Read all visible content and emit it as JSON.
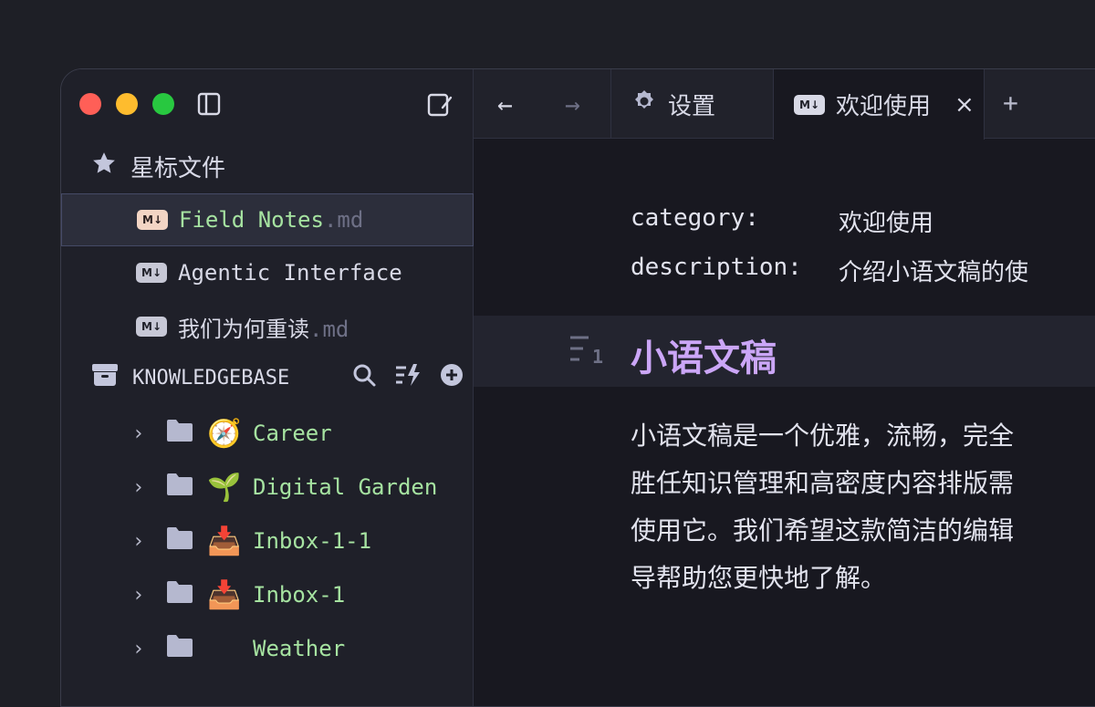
{
  "sidebar": {
    "starred": {
      "title": "星标文件",
      "files": [
        {
          "name": "Field Notes",
          "ext": ".md",
          "active": true,
          "badge": "M↓"
        },
        {
          "name": "Agentic Interface",
          "ext": "",
          "active": false,
          "badge": "M↓"
        },
        {
          "name": "我们为何重读",
          "ext": ".md",
          "active": false,
          "badge": "M↓"
        }
      ]
    },
    "knowledgebase": {
      "title": "KNOWLEDGEBASE",
      "folders": [
        {
          "emoji": "🧭",
          "name": "Career"
        },
        {
          "emoji": "🌱",
          "name": "Digital Garden"
        },
        {
          "emoji": "📥",
          "name": "Inbox-1-1"
        },
        {
          "emoji": "📥",
          "name": "Inbox-1"
        },
        {
          "emoji": "",
          "name": "Weather"
        }
      ]
    }
  },
  "tabs": {
    "back": "←",
    "forward": "→",
    "settings_label": "设置",
    "welcome_label": "欢迎使用",
    "welcome_badge": "M↓",
    "close": "×",
    "add": "+"
  },
  "editor": {
    "frontmatter": [
      {
        "key": "category:",
        "value": "欢迎使用"
      },
      {
        "key": "description:",
        "value": "介绍小语文稿的使"
      }
    ],
    "heading": "小语文稿",
    "heading_level": "1",
    "paragraph_lines": [
      "小语文稿是一个优雅，流畅，完全",
      "胜任知识管理和高密度内容排版需",
      "使用它。我们希望这款简洁的编辑",
      "导帮助您更快地了解。"
    ]
  }
}
